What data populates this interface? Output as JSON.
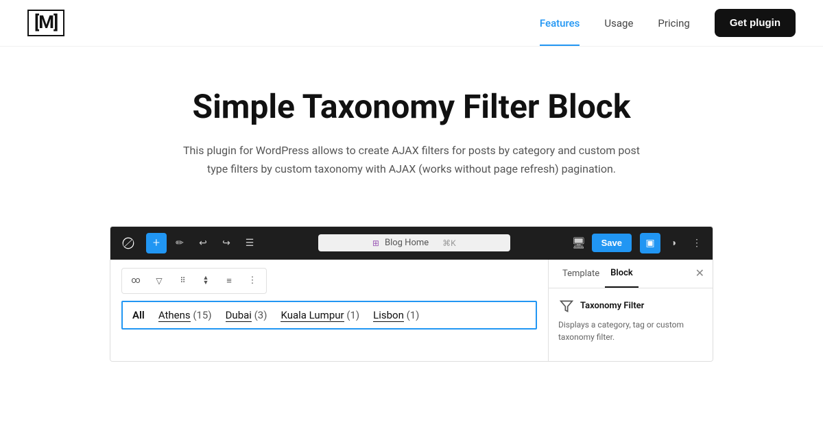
{
  "nav": {
    "logo": "[M]",
    "links": [
      {
        "label": "Features",
        "active": true
      },
      {
        "label": "Usage",
        "active": false
      },
      {
        "label": "Pricing",
        "active": false
      }
    ],
    "cta_label": "Get plugin"
  },
  "hero": {
    "title": "Simple Taxonomy Filter Block",
    "description": "This plugin for WordPress allows to create AJAX filters for posts by category and custom post type filters by custom taxonomy with AJAX (works without page refresh) pagination."
  },
  "editor": {
    "toolbar": {
      "add_icon": "+",
      "url_bar_icon": "⊞",
      "url_bar_text": "Blog Home",
      "url_shortcut": "⌘K",
      "save_label": "Save",
      "more_icon": "⋮"
    },
    "block_toolbar": {
      "link_icon": "∞",
      "filter_icon": "⛛",
      "drag_icon": "⠿",
      "arrows_icon": "⌃",
      "align_icon": "≡",
      "more_icon": "⋮"
    },
    "filter_block": {
      "items": [
        {
          "label": "All",
          "count": null,
          "is_link": false
        },
        {
          "label": "Athens",
          "count": 15,
          "is_link": true
        },
        {
          "label": "Dubai",
          "count": 3,
          "is_link": true
        },
        {
          "label": "Kuala Lumpur",
          "count": 1,
          "is_link": true
        },
        {
          "label": "Lisbon",
          "count": 1,
          "is_link": true
        }
      ]
    },
    "sidebar": {
      "tabs": [
        {
          "label": "Template",
          "active": false
        },
        {
          "label": "Block",
          "active": true
        }
      ],
      "block_name": "Taxonomy Filter",
      "block_desc": "Displays a category, tag or custom taxonomy filter."
    }
  },
  "colors": {
    "accent_blue": "#2196F3",
    "dark": "#1e1e1e",
    "border": "#e0e0e0"
  }
}
